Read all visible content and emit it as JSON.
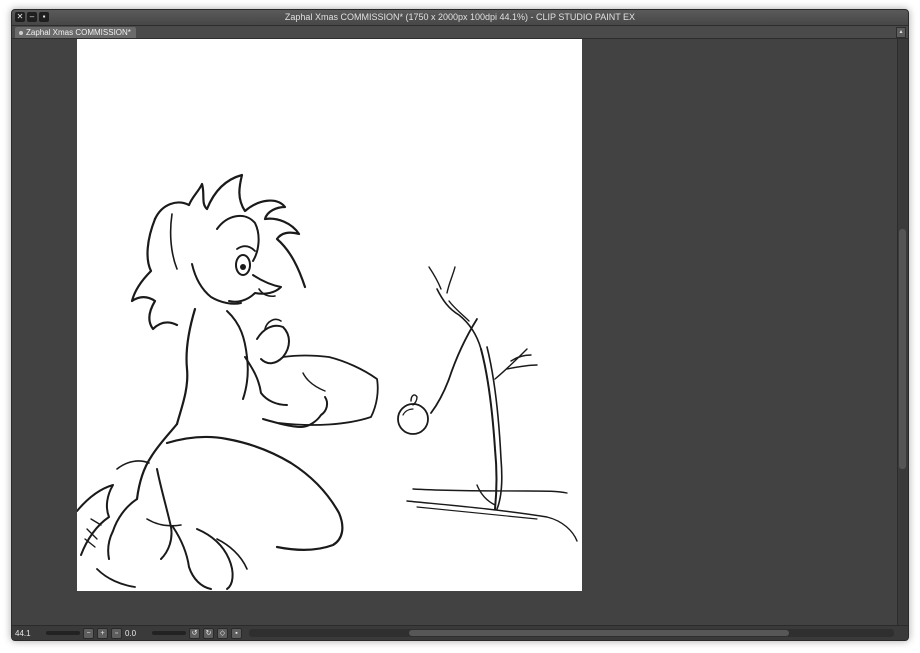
{
  "window": {
    "title": "Zaphal Xmas COMMISSION* (1750 x 2000px 100dpi 44.1%)  - CLIP STUDIO PAINT EX",
    "close_glyph": "✕",
    "minimize_glyph": "–",
    "maximize_glyph": "▪"
  },
  "tabs": [
    {
      "label": "Zaphal Xmas COMMISSION*"
    }
  ],
  "statusbar": {
    "zoom": "44.1",
    "angle": "0.0"
  },
  "colors": {
    "workspace": "#424242",
    "canvas": "#ffffff",
    "line": "#1a1a1a"
  }
}
